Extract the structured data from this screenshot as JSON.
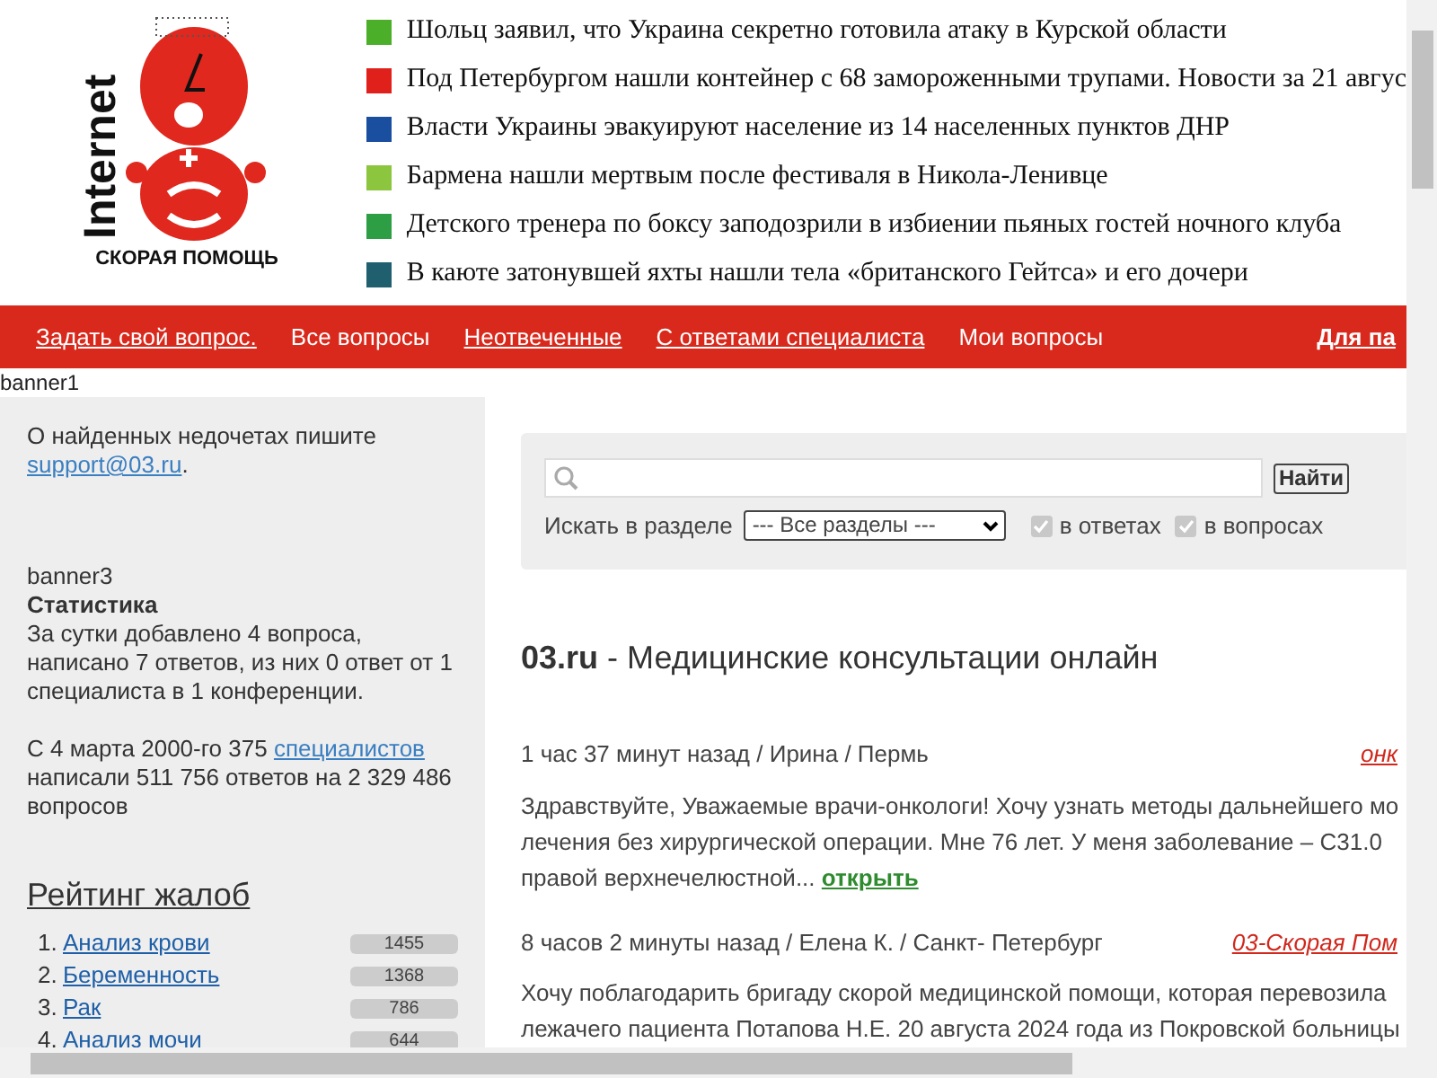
{
  "logo": {
    "word": "Internet",
    "caption": "СКОРАЯ ПОМОЩЬ"
  },
  "news": [
    {
      "text": "Шольц заявил, что Украина секретно готовила атаку в Курской области",
      "color": "#4caf2a"
    },
    {
      "text": "Под Петербургом нашли контейнер с 68 замороженными трупами. Новости за 21 авгус",
      "color": "#e0201b"
    },
    {
      "text": "Власти Украины эвакуируют население из 14 населенных пунктов ДНР",
      "color": "#1a4fa0"
    },
    {
      "text": "Бармена нашли мертвым после фестиваля в Никола-Ленивце",
      "color": "#8cc63f"
    },
    {
      "text": "Детского тренера по боксу заподозрили в избиении пьяных гостей ночного клуба",
      "color": "#2e9e44"
    },
    {
      "text": "В каюте затонувшей яхты нашли тела «британского Гейтса» и его дочери",
      "color": "#1f5f6e"
    }
  ],
  "nav": [
    {
      "label": "Задать свой вопрос.",
      "underlined": true
    },
    {
      "label": "Все вопросы",
      "underlined": false
    },
    {
      "label": "Неотвеченные",
      "underlined": true
    },
    {
      "label": "С ответами специалиста",
      "underlined": true
    },
    {
      "label": "Мои вопросы",
      "underlined": false
    },
    {
      "label": "Для па",
      "underlined": true
    }
  ],
  "banner1": "banner1",
  "sidebar": {
    "notice": "О найденных недочетах пишите",
    "email": "support@03.ru",
    "notice_end": ".",
    "banner3": "banner3",
    "stats_title": "Статистика",
    "stats_text": "За сутки добавлено 4 вопроса, написано 7 ответов, из них 0 ответ от 1 специалиста в 1 конференции.",
    "since_text": "С 4 марта 2000-го 375",
    "since_link": "специалистов",
    "since_rest": "написали 511 756 ответов на 2 329 486 вопросов",
    "rating_title": "Рейтинг жалоб",
    "rating": [
      {
        "num": "1.",
        "label": "Анализ крови",
        "count": "1455"
      },
      {
        "num": "2.",
        "label": "Беременность",
        "count": "1368"
      },
      {
        "num": "3.",
        "label": "Рак",
        "count": "786"
      },
      {
        "num": "4.",
        "label": "Анализ мочи",
        "count": "644"
      }
    ]
  },
  "search": {
    "button": "Найти",
    "section_label": "Искать в разделе",
    "section_value": "--- Все разделы ---",
    "options": [
      {
        "label": "в ответах",
        "checked": true
      },
      {
        "label": "в вопросах",
        "checked": true
      }
    ]
  },
  "heading_brand": "03.ru",
  "heading_rest": "- Медицинские консультации онлайн",
  "questions": [
    {
      "meta": "1 час 37 минут назад / Ирина / Пермь",
      "category": "онк",
      "lines": [
        "Здравствуйте, Уважаемые врачи-онкологи! Хочу узнать методы дальнейшего мо",
        "лечения без хирургической операции. Мне 76 лет. У меня заболевание – С31.0",
        "правой верхнечелюстной..."
      ],
      "open": "открыть"
    },
    {
      "meta": "8 часов 2 минуты назад / Елена К. / Санкт- Петербург",
      "category": "03-Скорая Пом",
      "lines": [
        "Хочу поблагодарить бригаду скорой медицинской помощи, которая перевозила",
        "лежачего пациента Потапова Н.Е. 20 августа 2024 года из Покровской больницы"
      ]
    }
  ]
}
